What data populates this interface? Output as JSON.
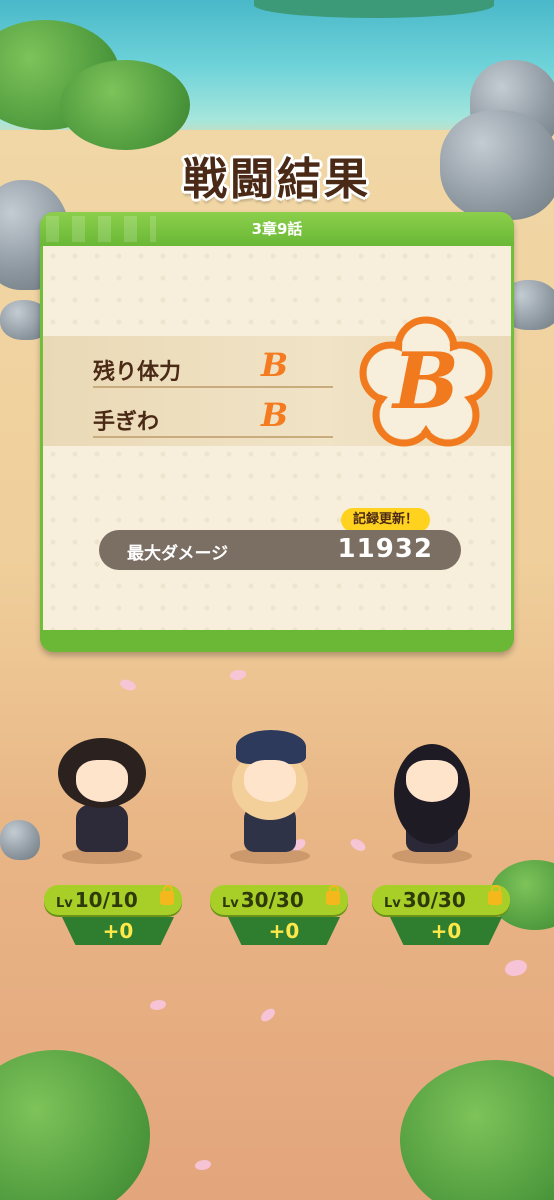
{
  "title": "戦闘結果",
  "chapter": "3章9話",
  "results": [
    {
      "label": "残り体力",
      "grade": "B"
    },
    {
      "label": "手ぎわ",
      "grade": "B"
    }
  ],
  "overall_grade": "B",
  "max_damage": {
    "label": "最大ダメージ",
    "value": "11932",
    "badge": "記録更新！"
  },
  "characters": [
    {
      "level": "10/10",
      "exp": "+0"
    },
    {
      "level": "30/30",
      "exp": "+0"
    },
    {
      "level": "30/30",
      "exp": "+0"
    }
  ],
  "level_prefix": "Lv",
  "colors": {
    "accent_green": "#6fbf3a",
    "grade_orange": "#f47b1f",
    "exp_yellow": "#ffe94a"
  }
}
